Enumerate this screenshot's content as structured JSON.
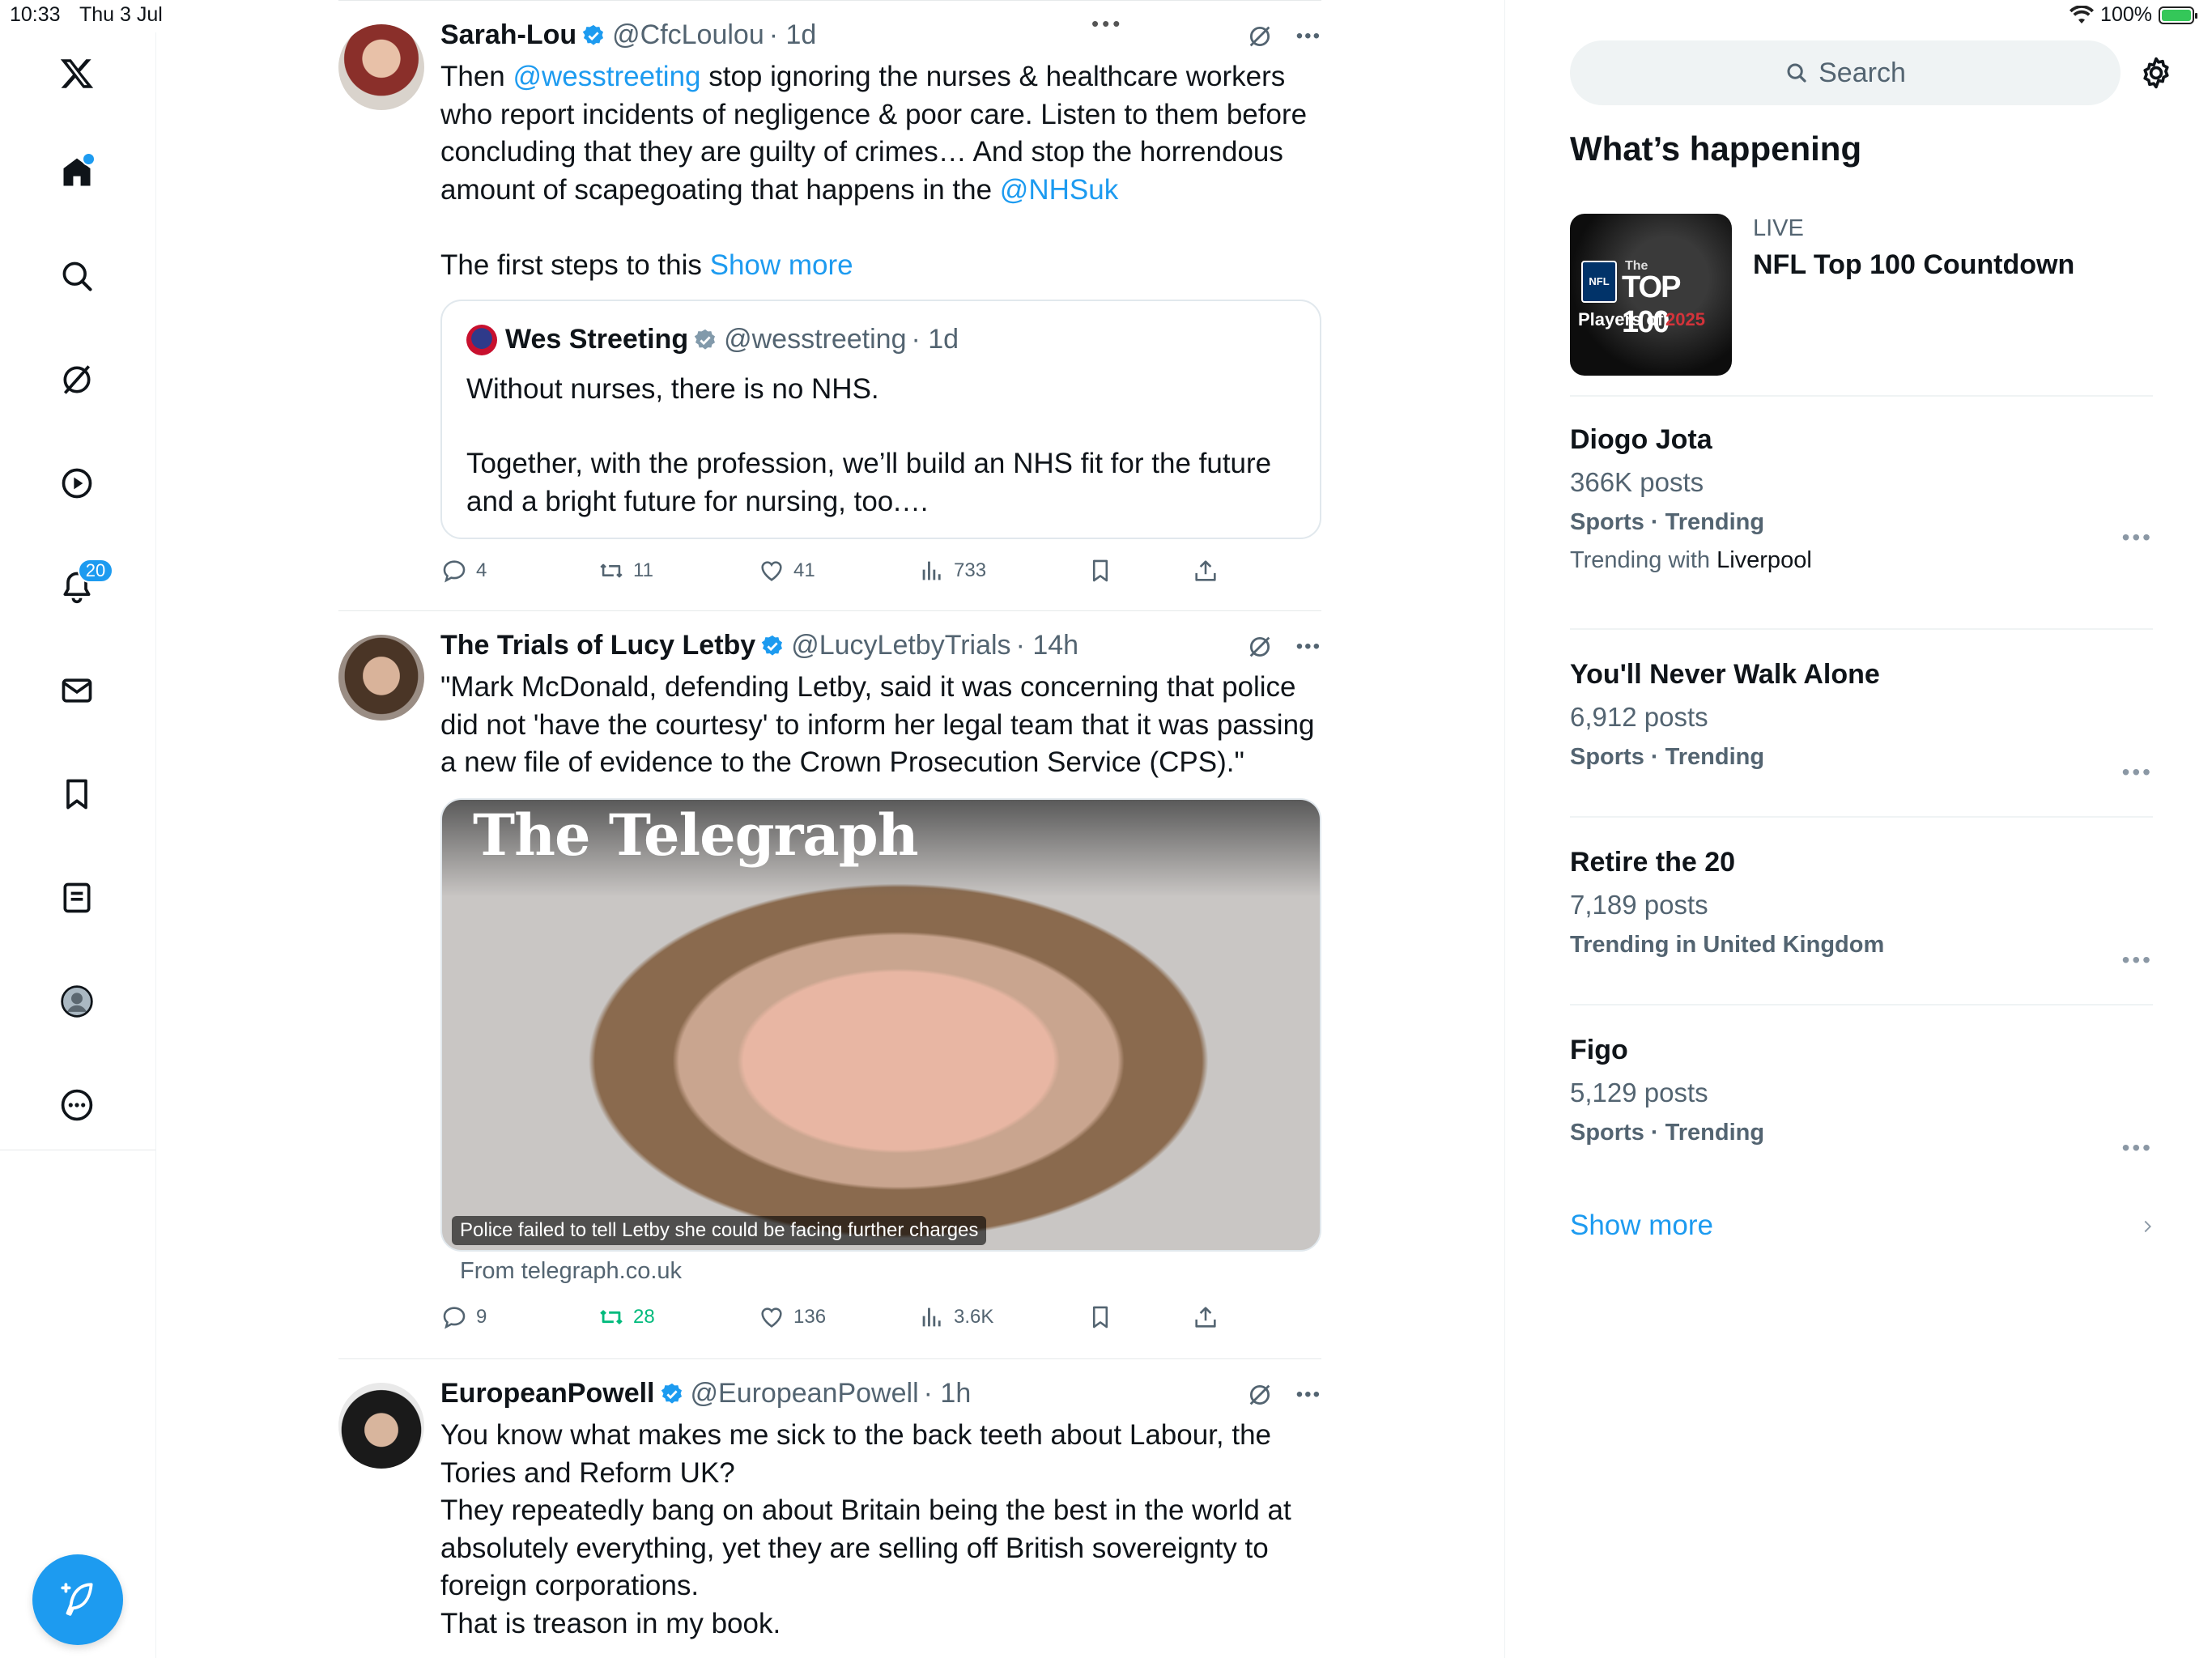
{
  "status_bar": {
    "time": "10:33",
    "date": "Thu 3 Jul",
    "battery": "100%",
    "battery_level": 1.0
  },
  "nav": {
    "notifications_badge": "20",
    "items": [
      "home-icon",
      "search-icon",
      "grok-icon",
      "video-icon",
      "bell-icon",
      "mail-icon",
      "bookmark-icon",
      "list-icon",
      "profile-icon",
      "more-icon"
    ],
    "accent": "#1d9bf0"
  },
  "feed": {
    "tweets": [
      {
        "name": "Sarah-Lou",
        "handle": "@CfcLoulou",
        "time": "· 1d",
        "body_parts": [
          "Then ",
          "@wesstreeting",
          " stop ignoring the nurses & healthcare workers who report incidents of negligence & poor care.  Listen to them before concluding that they are guilty of crimes… And stop the horrendous amount of scapegoating that happens in the ",
          "@NHSuk"
        ],
        "body2": "The first steps to this ",
        "show_more": "Show more",
        "quote": {
          "name": "Wes Streeting",
          "handle": "@wesstreeting",
          "time": "· 1d",
          "line1": "Without nurses, there is no NHS.",
          "line2": "Together, with the profession, we’ll build an NHS fit for the future and a bright future for nursing, too.…"
        },
        "actions": {
          "replies": "4",
          "reposts": "11",
          "likes": "41",
          "views": "733"
        }
      },
      {
        "name": "The Trials of Lucy Letby",
        "handle": "@LucyLetbyTrials",
        "time": "· 14h",
        "body": "\"Mark McDonald, defending Letby, said it was concerning that police did not 'have the courtesy' to inform her legal team that it was passing a new file of evidence to the Crown Prosecution Service (CPS).\"",
        "card": {
          "masthead": "The Telegraph",
          "caption": "Police failed to tell Letby she could be facing further charges",
          "source": "From telegraph.co.uk"
        },
        "actions": {
          "replies": "9",
          "reposts": "28",
          "likes": "136",
          "views": "3.6K"
        }
      },
      {
        "name": "EuropeanPowell",
        "handle": "@EuropeanPowell",
        "time": "· 1h",
        "body_lines": [
          "You know what makes me sick to the back teeth about Labour, the Tories and Reform UK?",
          "They repeatedly bang on about Britain being the best in the world at absolutely everything, yet they are selling off British sovereignty to foreign corporations.",
          "That is treason in my book."
        ]
      }
    ]
  },
  "sidebar": {
    "search_placeholder": "Search",
    "title": "What’s happening",
    "live": {
      "label": "LIVE",
      "title": "NFL Top 100 Countdown",
      "thumb_lines": [
        "NFL",
        "The",
        "TOP 100",
        "Players of",
        "2025"
      ]
    },
    "trends": [
      {
        "title": "Diogo Jota",
        "posts": "366K posts",
        "category": "Sports · Trending",
        "with_prefix": "Trending with ",
        "with": "Liverpool"
      },
      {
        "title": "You'll Never Walk Alone",
        "posts": "6,912 posts",
        "category": "Sports · Trending"
      },
      {
        "title": "Retire the 20",
        "posts": "7,189 posts",
        "category": "Trending in United Kingdom"
      },
      {
        "title": "Figo",
        "posts": "5,129 posts",
        "category": "Sports · Trending"
      }
    ],
    "show_more": "Show more",
    "more_glyph": "•••"
  }
}
